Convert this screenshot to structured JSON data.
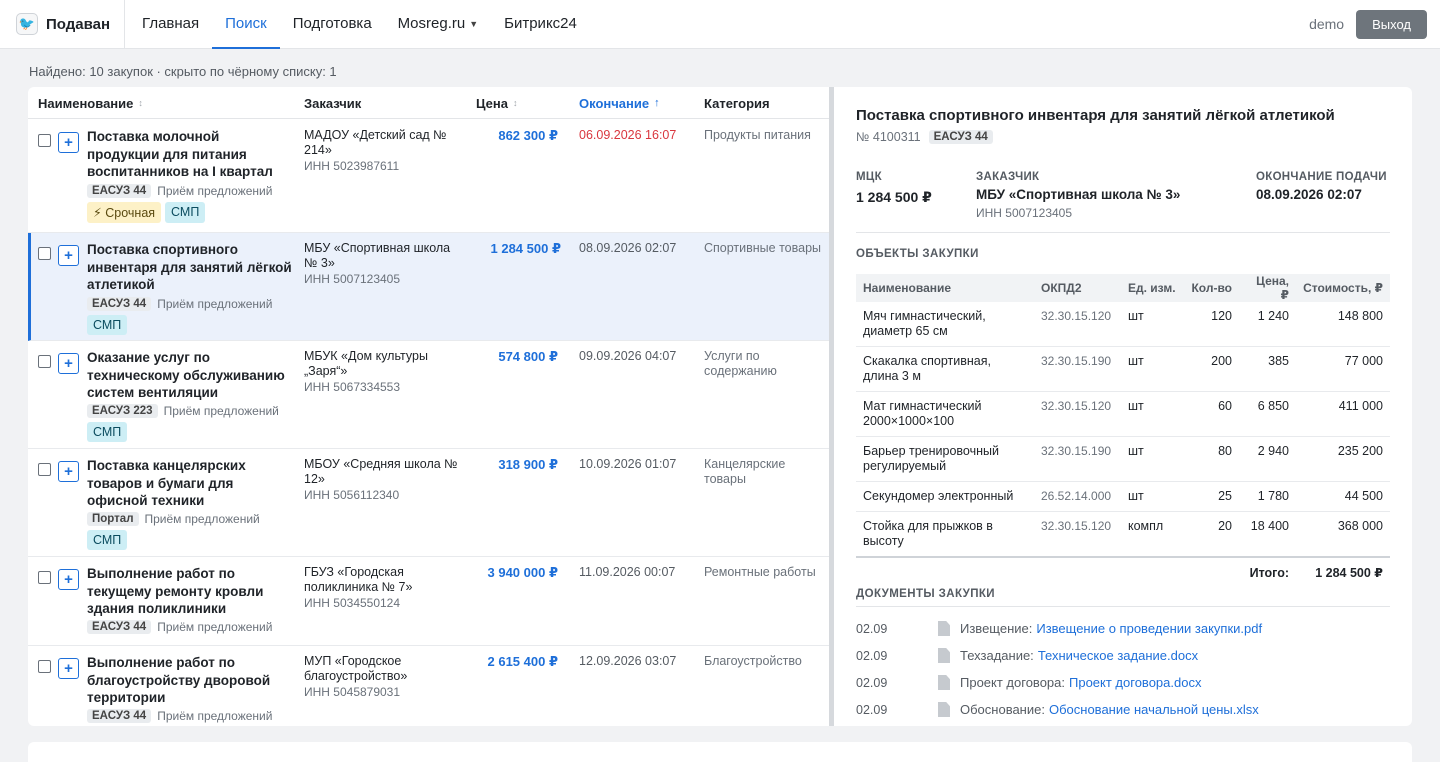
{
  "brand": {
    "name": "Подаван",
    "logo": "bird-logo-icon"
  },
  "nav": [
    {
      "label": "Главная",
      "active": false
    },
    {
      "label": "Поиск",
      "active": true
    },
    {
      "label": "Подготовка",
      "active": false
    },
    {
      "label": "Mosreg.ru",
      "active": false,
      "dropdown": true
    },
    {
      "label": "Битрикс24",
      "active": false
    }
  ],
  "user": {
    "name": "demo",
    "logout": "Выход"
  },
  "summary": "Найдено: 10 закупок · скрыто по чёрному списку: 1",
  "list": {
    "headers": {
      "name": "Наименование",
      "customer": "Заказчик",
      "price": "Цена",
      "end": "Окончание",
      "category": "Категория"
    },
    "rows": [
      {
        "title": "Поставка молочной продукции для питания воспитанников на I квартал",
        "tag": "ЕАСУЗ 44",
        "stage": "Приём предложений",
        "urgent": "⚡ Срочная",
        "smp": "СМП",
        "customer": "МАДОУ «Детский сад № 214»",
        "inn": "ИНН 5023987611",
        "price": "862 300 ₽",
        "end": "06.09.2026 16:07",
        "end_urgent": true,
        "category": "Продукты питания"
      },
      {
        "title": "Поставка спортивного инвентаря для занятий лёгкой атлетикой",
        "tag": "ЕАСУЗ 44",
        "stage": "Приём предложений",
        "smp": "СМП",
        "customer": "МБУ «Спортивная школа № 3»",
        "inn": "ИНН 5007123405",
        "price": "1 284 500 ₽",
        "end": "08.09.2026 02:07",
        "category": "Спортивные товары",
        "selected": true
      },
      {
        "title": "Оказание услуг по техническому обслуживанию систем вентиляции",
        "tag": "ЕАСУЗ 223",
        "stage": "Приём предложений",
        "smp": "СМП",
        "customer": "МБУК «Дом культуры „Заря“»",
        "inn": "ИНН 5067334553",
        "price": "574 800 ₽",
        "end": "09.09.2026 04:07",
        "category": "Услуги по содержанию"
      },
      {
        "title": "Поставка канцелярских товаров и бумаги для офисной техники",
        "tag": "Портал",
        "stage": "Приём предложений",
        "smp": "СМП",
        "customer": "МБОУ «Средняя школа № 12»",
        "inn": "ИНН 5056112340",
        "price": "318 900 ₽",
        "end": "10.09.2026 01:07",
        "category": "Канцелярские товары"
      },
      {
        "title": "Выполнение работ по текущему ремонту кровли здания поликлиники",
        "tag": "ЕАСУЗ 44",
        "stage": "Приём предложений",
        "customer": "ГБУЗ «Городская поликлиника № 7»",
        "inn": "ИНН 5034550124",
        "price": "3 940 000 ₽",
        "end": "11.09.2026 00:07",
        "category": "Ремонтные работы"
      },
      {
        "title": "Выполнение работ по благоустройству дворовой территории",
        "tag": "ЕАСУЗ 44",
        "stage": "Приём предложений",
        "customer": "МУП «Городское благоустройство»",
        "inn": "ИНН 5045879031",
        "price": "2 615 400 ₽",
        "end": "12.09.2026 03:07",
        "category": "Благоустройство"
      }
    ]
  },
  "detail": {
    "title": "Поставка спортивного инвентаря для занятий лёгкой атлетикой",
    "number": "№ 4100311",
    "tag": "ЕАСУЗ 44",
    "mck_label": "МЦК",
    "mck_value": "1 284 500 ₽",
    "customer_label": "ЗАКАЗЧИК",
    "customer_value": "МБУ «Спортивная школа № 3»",
    "customer_inn": "ИНН 5007123405",
    "deadline_label": "ОКОНЧАНИЕ ПОДАЧИ",
    "deadline_value": "08.09.2026 02:07",
    "objects_label": "ОБЪЕКТЫ ЗАКУПКИ",
    "columns": {
      "name": "Наименование",
      "okpd": "ОКПД2",
      "unit": "Ед. изм.",
      "qty": "Кол-во",
      "price": "Цена, ₽",
      "cost": "Стоимость, ₽"
    },
    "items": [
      {
        "name": "Мяч гимнастический, диаметр 65 см",
        "okpd": "32.30.15.120",
        "unit": "шт",
        "qty": "120",
        "price": "1 240",
        "cost": "148 800"
      },
      {
        "name": "Скакалка спортивная, длина 3 м",
        "okpd": "32.30.15.190",
        "unit": "шт",
        "qty": "200",
        "price": "385",
        "cost": "77 000"
      },
      {
        "name": "Мат гимнастический 2000×1000×100",
        "okpd": "32.30.15.120",
        "unit": "шт",
        "qty": "60",
        "price": "6 850",
        "cost": "411 000"
      },
      {
        "name": "Барьер тренировочный регулируемый",
        "okpd": "32.30.15.190",
        "unit": "шт",
        "qty": "80",
        "price": "2 940",
        "cost": "235 200"
      },
      {
        "name": "Секундомер электронный",
        "okpd": "26.52.14.000",
        "unit": "шт",
        "qty": "25",
        "price": "1 780",
        "cost": "44 500"
      },
      {
        "name": "Стойка для прыжков в высоту",
        "okpd": "32.30.15.120",
        "unit": "компл",
        "qty": "20",
        "price": "18 400",
        "cost": "368 000"
      }
    ],
    "total_label": "Итого:",
    "total_value": "1 284 500 ₽",
    "docs_label": "ДОКУМЕНТЫ ЗАКУПКИ",
    "docs": [
      {
        "date": "02.09",
        "type": "Извещение:",
        "name": "Извещение о проведении закупки.pdf"
      },
      {
        "date": "02.09",
        "type": "Техзадание:",
        "name": "Техническое задание.docx"
      },
      {
        "date": "02.09",
        "type": "Проект договора:",
        "name": "Проект договора.docx"
      },
      {
        "date": "02.09",
        "type": "Обоснование:",
        "name": "Обоснование начальной цены.xlsx"
      }
    ]
  },
  "colors": {
    "accent": "#1e6fd9",
    "urgent": "#d9363e",
    "smp": "#cdeef5",
    "urgent_badge": "#fdf1c7"
  }
}
